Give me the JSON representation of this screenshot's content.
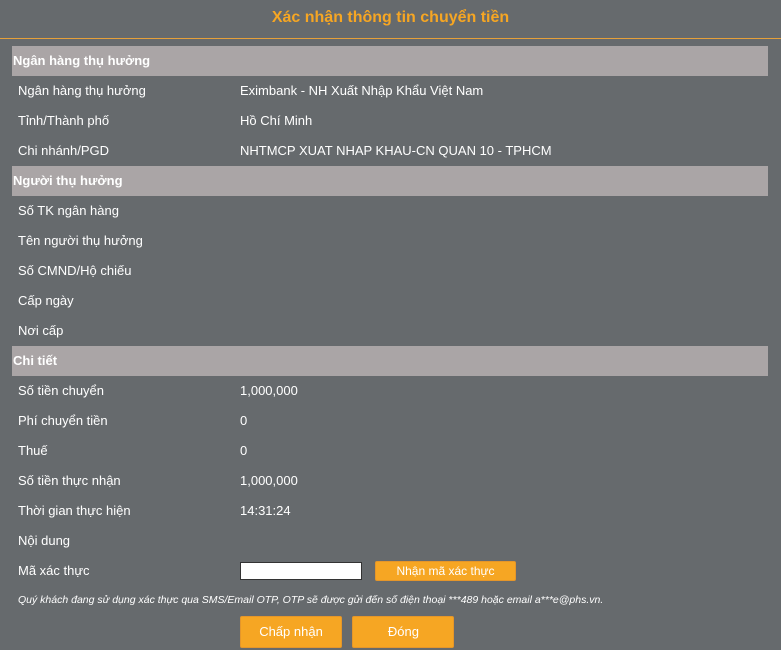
{
  "title": "Xác nhận thông tin chuyển tiền",
  "bank_section": {
    "header": "Ngân hàng thụ hưởng",
    "rows": [
      {
        "label": "Ngân hàng thụ hưởng",
        "value": "Eximbank - NH Xuất Nhập Khẩu Việt Nam"
      },
      {
        "label": "Tỉnh/Thành phố",
        "value": "Hồ Chí Minh"
      },
      {
        "label": "Chi nhánh/PGD",
        "value": "NHTMCP XUAT NHAP KHAU-CN QUAN 10 - TPHCM"
      }
    ]
  },
  "beneficiary_section": {
    "header": "Người thụ hưởng",
    "rows": [
      {
        "label": "Số TK ngân hàng",
        "value": ""
      },
      {
        "label": "Tên người thụ hưởng",
        "value": ""
      },
      {
        "label": "Số CMND/Hộ chiếu",
        "value": ""
      },
      {
        "label": "Cấp ngày",
        "value": ""
      },
      {
        "label": "Nơi cấp",
        "value": ""
      }
    ]
  },
  "detail_section": {
    "header": "Chi tiết",
    "rows": [
      {
        "label": "Số tiền chuyển",
        "value": "1,000,000"
      },
      {
        "label": "Phí chuyển tiền",
        "value": "0"
      },
      {
        "label": "Thuế",
        "value": "0"
      },
      {
        "label": "Số tiền thực nhận",
        "value": "1,000,000"
      },
      {
        "label": "Thời gian thực hiện",
        "value": "14:31:24"
      },
      {
        "label": "Nội dung",
        "value": ""
      }
    ]
  },
  "otp": {
    "label": "Mã xác thực",
    "value": "",
    "placeholder": "",
    "button_label": "Nhận mã xác thực"
  },
  "note": "Quý khách đang sử dụng xác thực qua SMS/Email OTP, OTP sẽ được gửi đến số điện thoại ***489 hoặc email a***e@phs.vn.",
  "actions": {
    "accept_label": "Chấp nhận",
    "close_label": "Đóng"
  },
  "colors": {
    "accent": "#f6a623",
    "section_header_bg": "#aaa5a6",
    "background": "#666a6d"
  }
}
